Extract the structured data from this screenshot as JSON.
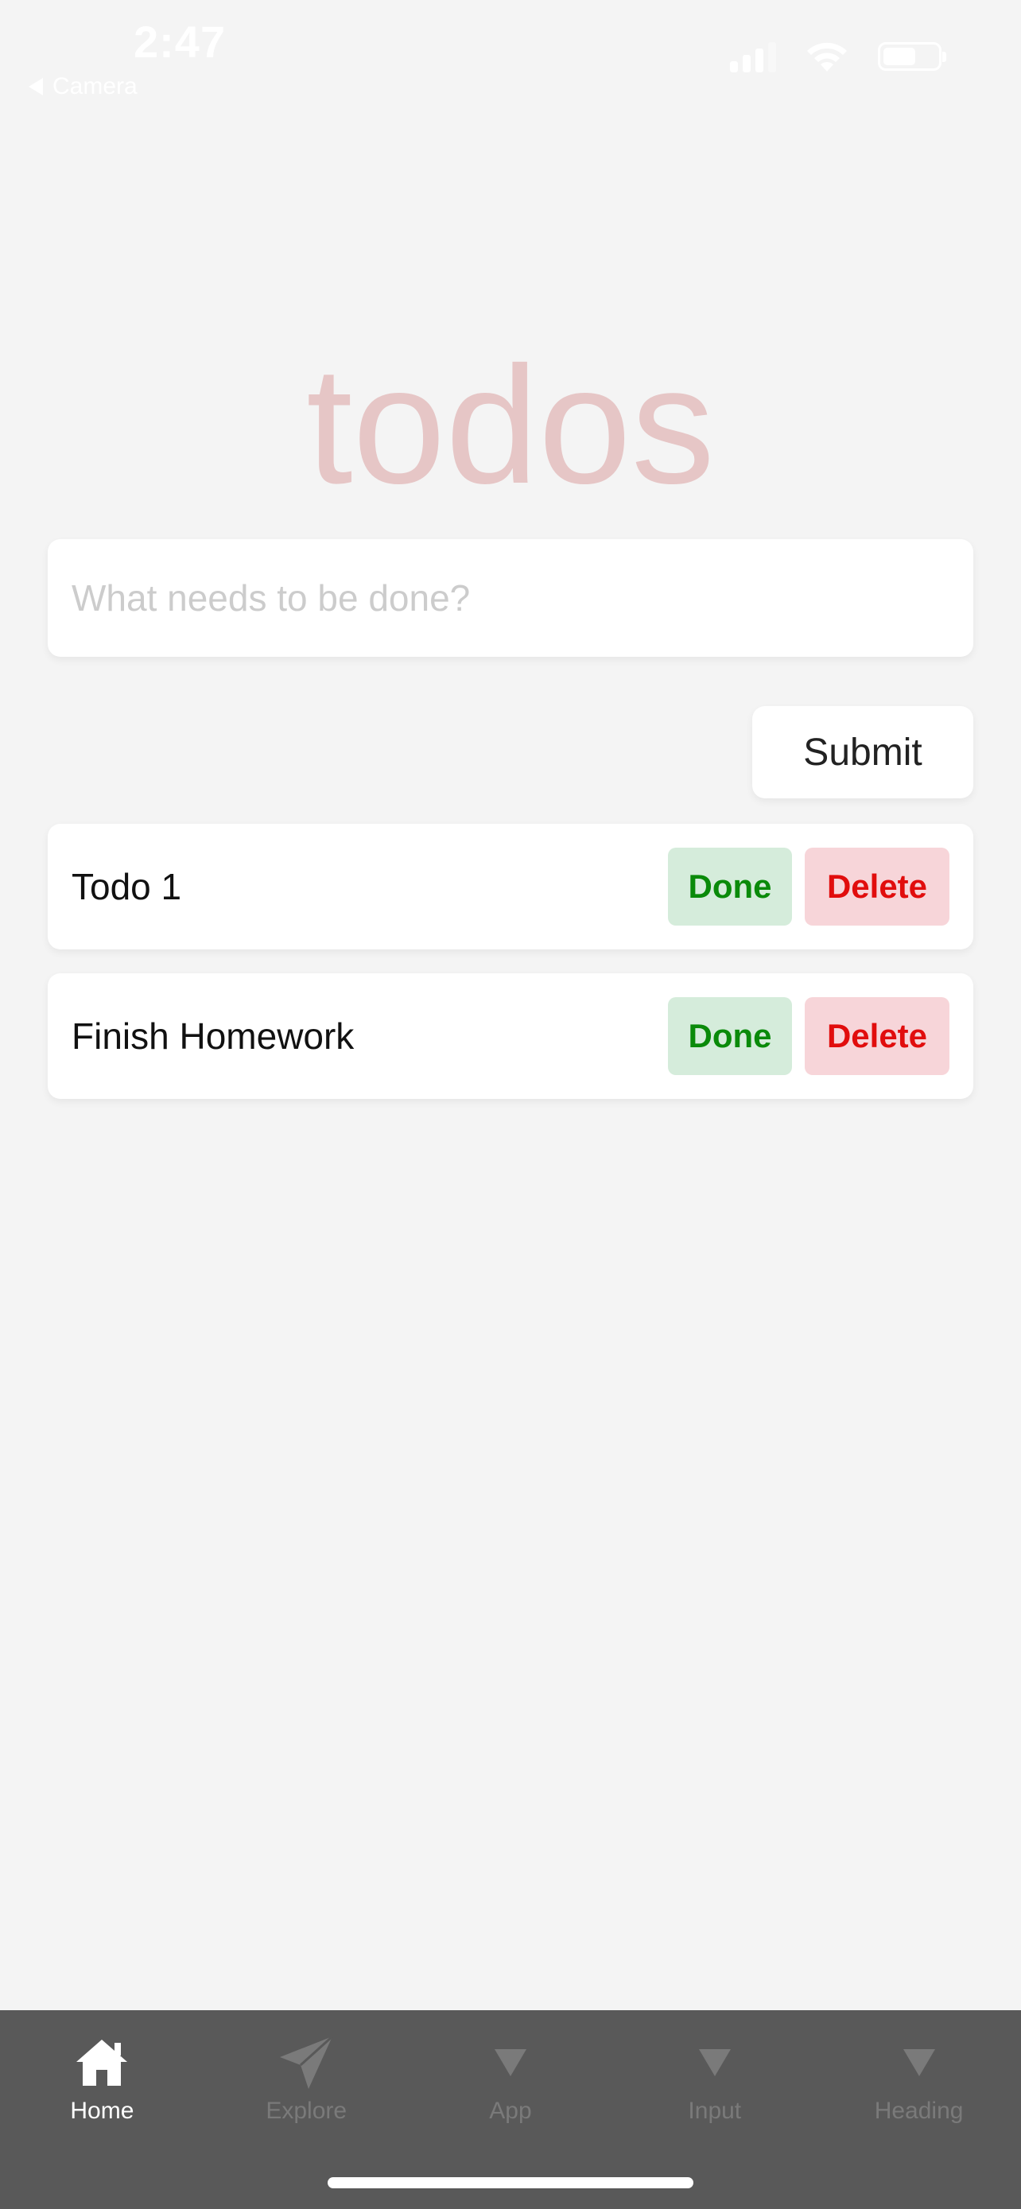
{
  "status_bar": {
    "time": "2:47",
    "back_label": "Camera"
  },
  "app": {
    "title": "todos"
  },
  "input": {
    "placeholder": "What needs to be done?",
    "value": ""
  },
  "submit_label": "Submit",
  "todos": [
    {
      "text": "Todo 1",
      "done_label": "Done",
      "delete_label": "Delete"
    },
    {
      "text": "Finish Homework",
      "done_label": "Done",
      "delete_label": "Delete"
    }
  ],
  "tab_bar": {
    "active_index": 0,
    "tabs": [
      {
        "label": "Home",
        "icon": "home-icon"
      },
      {
        "label": "Explore",
        "icon": "paper-plane-icon"
      },
      {
        "label": "App",
        "icon": "triangle-down-icon"
      },
      {
        "label": "Input",
        "icon": "triangle-down-icon"
      },
      {
        "label": "Heading",
        "icon": "triangle-down-icon"
      }
    ]
  },
  "colors": {
    "background": "#f4f4f4",
    "title": "#e6c6c6",
    "done_bg": "#d5ecdb",
    "done_text": "#0a8a0a",
    "delete_bg": "#f7d5d9",
    "delete_text": "#e10d0d",
    "tab_bar_bg": "#595959"
  }
}
